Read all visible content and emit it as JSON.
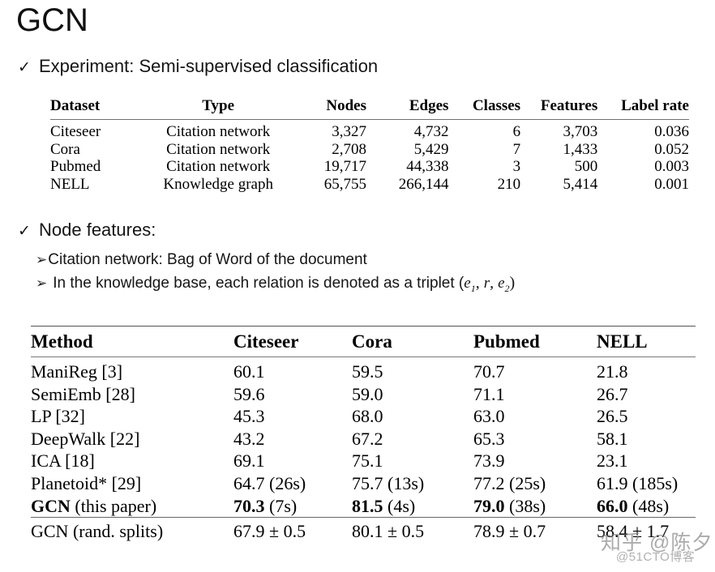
{
  "slide": {
    "title": "GCN"
  },
  "bullets": {
    "experiment": {
      "check_glyph": "✓",
      "text": "Experiment: Semi-supervised classification"
    },
    "node_features": {
      "check_glyph": "✓",
      "text": "Node features:"
    },
    "sub_citation": {
      "arrow_glyph": "➢",
      "text": "Citation network: Bag of Word of the document"
    },
    "sub_knowledge_base": {
      "arrow_glyph": "➢",
      "text_before": "In the knowledge base, each relation is denoted as a triplet (",
      "var1": "e",
      "sub1": "1",
      "sep1": ", ",
      "var2": "r",
      "sep2": ", ",
      "var3": "e",
      "sub3": "2",
      "text_after": ")"
    }
  },
  "table_datasets": {
    "headers": [
      "Dataset",
      "Type",
      "Nodes",
      "Edges",
      "Classes",
      "Features",
      "Label rate"
    ],
    "rows": [
      {
        "dataset": "Citeseer",
        "type": "Citation network",
        "nodes": "3,327",
        "edges": "4,732",
        "classes": "6",
        "features": "3,703",
        "label_rate": "0.036"
      },
      {
        "dataset": "Cora",
        "type": "Citation network",
        "nodes": "2,708",
        "edges": "5,429",
        "classes": "7",
        "features": "1,433",
        "label_rate": "0.052"
      },
      {
        "dataset": "Pubmed",
        "type": "Citation network",
        "nodes": "19,717",
        "edges": "44,338",
        "classes": "3",
        "features": "500",
        "label_rate": "0.003"
      },
      {
        "dataset": "NELL",
        "type": "Knowledge graph",
        "nodes": "65,755",
        "edges": "266,144",
        "classes": "210",
        "features": "5,414",
        "label_rate": "0.001"
      }
    ]
  },
  "table_results": {
    "headers": [
      "Method",
      "Citeseer",
      "Cora",
      "Pubmed",
      "NELL"
    ],
    "rows": [
      {
        "method": "ManiReg [3]",
        "citeseer": "60.1",
        "cora": "59.5",
        "pubmed": "70.7",
        "nell": "21.8"
      },
      {
        "method": "SemiEmb [28]",
        "citeseer": "59.6",
        "cora": "59.0",
        "pubmed": "71.1",
        "nell": "26.7"
      },
      {
        "method": "LP [32]",
        "citeseer": "45.3",
        "cora": "68.0",
        "pubmed": "63.0",
        "nell": "26.5"
      },
      {
        "method": "DeepWalk [22]",
        "citeseer": "43.2",
        "cora": "67.2",
        "pubmed": "65.3",
        "nell": "58.1"
      },
      {
        "method": "ICA [18]",
        "citeseer": "69.1",
        "cora": "75.1",
        "pubmed": "73.9",
        "nell": "23.1"
      },
      {
        "method": "Planetoid* [29]",
        "citeseer": "64.7 (26s)",
        "cora": "75.7 (13s)",
        "pubmed": "77.2 (25s)",
        "nell": "61.9 (185s)"
      }
    ],
    "gcn_row": {
      "method_bold": "GCN",
      "method_rest": " (this paper)",
      "citeseer_value": "70.3",
      "citeseer_time": " (7s)",
      "cora_value": "81.5",
      "cora_time": " (4s)",
      "pubmed_value": "79.0",
      "pubmed_time": " (38s)",
      "nell_value": "66.0",
      "nell_time": " (48s)"
    },
    "gcn_rand_row": {
      "method": "GCN (rand. splits)",
      "citeseer": "67.9 ± 0.5",
      "cora": "80.1 ± 0.5",
      "pubmed": "78.9 ± 0.7",
      "nell": "58.4 ± 1.7"
    }
  },
  "watermarks": {
    "zhihu": "知乎 @陈夕",
    "cto": "@51CTO博客"
  }
}
